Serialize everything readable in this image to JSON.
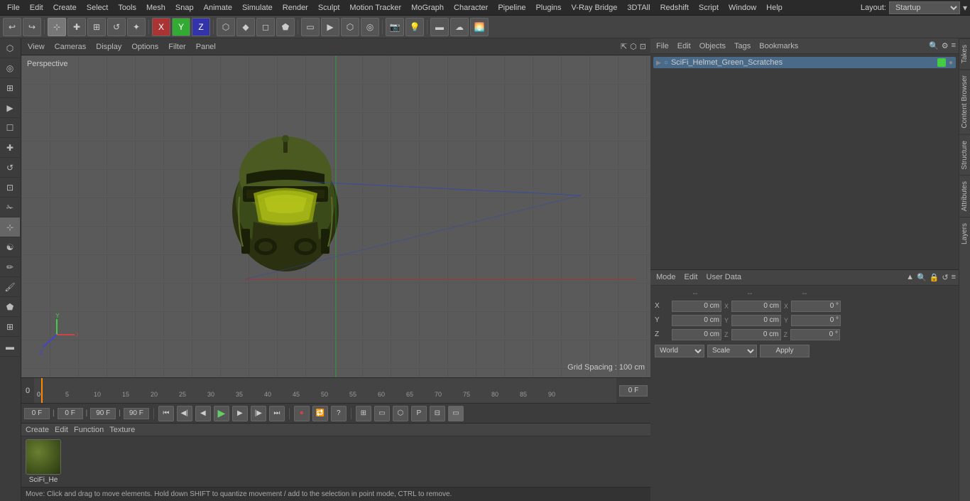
{
  "menubar": {
    "items": [
      "File",
      "Edit",
      "Create",
      "Select",
      "Tools",
      "Mesh",
      "Snap",
      "Animate",
      "Simulate",
      "Render",
      "Sculpt",
      "Motion Tracker",
      "MoGraph",
      "Character",
      "Pipeline",
      "Plugins",
      "V-Ray Bridge",
      "3DTAll",
      "Redshift",
      "Script",
      "Window",
      "Help"
    ],
    "layout_label": "Layout:",
    "layout_value": "Startup"
  },
  "toolbar": {
    "undo_label": "↩",
    "move_label": "↔",
    "scale_label": "⊞",
    "rotate_label": "↺",
    "tools": [
      "✦",
      "✚",
      "☐",
      "↺",
      "✚",
      "X",
      "Y",
      "Z",
      "☐",
      "▶",
      "⬡",
      "◆",
      "⬟",
      "◉",
      "▭",
      "◻",
      "⬡",
      "◎",
      "📷",
      "💡"
    ]
  },
  "viewport": {
    "label": "Perspective",
    "menu_items": [
      "View",
      "Cameras",
      "Display",
      "Options",
      "Filter",
      "Panel"
    ],
    "grid_spacing": "Grid Spacing : 100 cm"
  },
  "timeline": {
    "ticks": [
      0,
      5,
      10,
      15,
      20,
      25,
      30,
      35,
      40,
      45,
      50,
      55,
      60,
      65,
      70,
      75,
      80,
      85,
      90
    ],
    "frame_label": "0 F",
    "start_frame": "0 F",
    "end_frame": "90 F",
    "preview_start": "90 F"
  },
  "transport": {
    "start_frame": "0 F",
    "end_frame": "90 F",
    "preview_start": "90 F",
    "buttons": [
      "⏮",
      "◀◀",
      "▶",
      "▶▶",
      "⏭",
      "↺"
    ],
    "record_btn": "⏺",
    "loop_btn": "🔁",
    "help_btn": "?"
  },
  "objects_panel": {
    "toolbar_items": [
      "File",
      "Edit",
      "Objects",
      "Tags",
      "Bookmarks"
    ],
    "search_icon": "🔍",
    "items": [
      {
        "name": "SciFi_Helmet_Green_Scratches",
        "color": "#44cc44",
        "icon": "🎭",
        "type": "mesh"
      }
    ]
  },
  "attributes_panel": {
    "toolbar_items": [
      "Mode",
      "Edit",
      "User Data"
    ],
    "coord_headers": [
      "--",
      "--",
      "--"
    ],
    "rows": [
      {
        "label": "X",
        "val1": "0 cm",
        "val2": "0 cm",
        "val3": "0 °"
      },
      {
        "label": "Y",
        "val1": "0 cm",
        "val2": "0 cm",
        "val3": "0 °"
      },
      {
        "label": "Z",
        "val1": "0 cm",
        "val2": "0 cm",
        "val3": "0 °"
      }
    ],
    "world_label": "World",
    "scale_label": "Scale",
    "apply_label": "Apply"
  },
  "material_panel": {
    "toolbar_items": [
      "Create",
      "Edit",
      "Function",
      "Texture"
    ],
    "materials": [
      {
        "name": "SciFi_He",
        "thumb_color1": "#5a7020",
        "thumb_color2": "#2a3810"
      }
    ]
  },
  "status_bar": {
    "text": "Move: Click and drag to move elements. Hold down SHIFT to quantize movement / add to the selection in point mode, CTRL to remove."
  },
  "vtabs": {
    "right": [
      "Takes",
      "Content Browser",
      "Structure",
      "Attributes",
      "Layers"
    ]
  },
  "icons": {
    "search": "🔍",
    "gear": "⚙",
    "lock": "🔒",
    "plus": "+",
    "minus": "-"
  }
}
